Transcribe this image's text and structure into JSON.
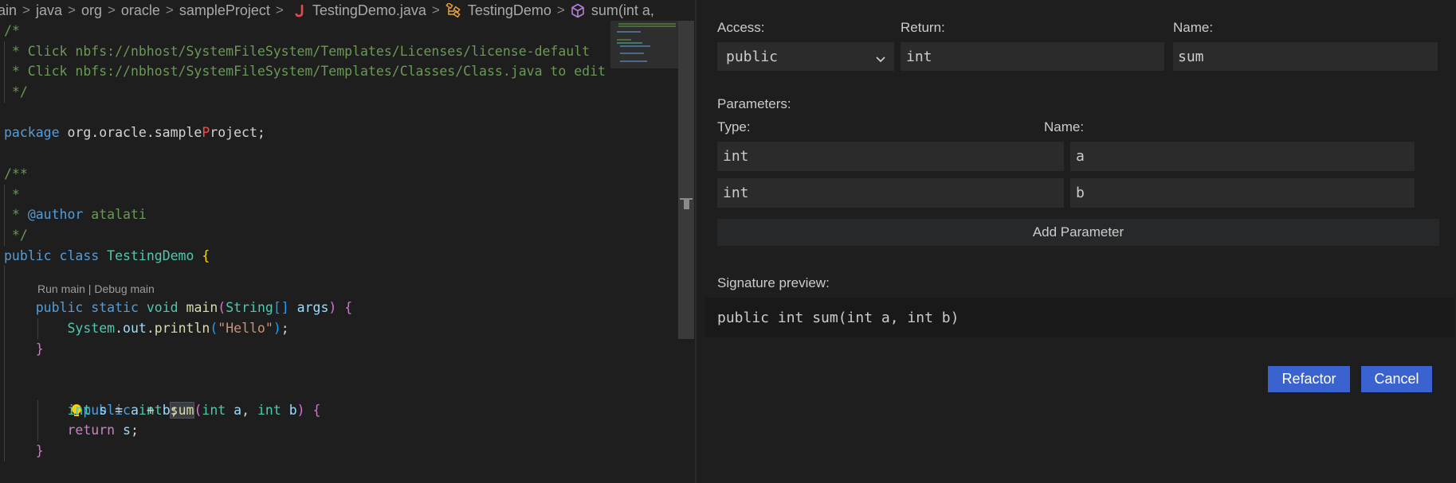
{
  "breadcrumb": {
    "items": [
      "ain",
      "java",
      "org",
      "oracle",
      "sampleProject",
      "TestingDemo.java",
      "TestingDemo",
      "sum(int a,"
    ],
    "icons": [
      "java-file-icon",
      "class-icon",
      "method-icon"
    ]
  },
  "editor": {
    "code": {
      "l1": "/*",
      "l2": " * Click nbfs://nbhost/SystemFileSystem/Templates/Licenses/license-default",
      "l3": " * Click nbfs://nbhost/SystemFileSystem/Templates/Classes/Class.java to edit",
      "l4": " */",
      "pkg_kw": "package",
      "pkg_a": " org.oracle.sample",
      "pkg_err": "P",
      "pkg_b": "roject;",
      "doc_open": "/**",
      "doc_star": " *",
      "doc_author_star": " * ",
      "doc_author_tag": "@author",
      "doc_author_name": " atalati",
      "doc_close": " */",
      "cls_public": "public",
      "cls_class": "class",
      "cls_name": "TestingDemo",
      "cls_brace": "{",
      "codelens_run": "Run main",
      "codelens_sep": " | ",
      "codelens_debug": "Debug main",
      "main_public": "public",
      "main_static": "static",
      "main_void": "void",
      "main_name": "main",
      "main_type": "String",
      "main_arr": "[]",
      "main_arg": "args",
      "println_sys": "System",
      "println_out": "out",
      "println_fn": "println",
      "println_str": "\"Hello\"",
      "sum_public": "public",
      "sum_int": "int",
      "sum_name": "sum",
      "sum_p1t": "int",
      "sum_p1": "a",
      "sum_p2t": "int",
      "sum_p2": "b",
      "body_int": "int",
      "body_s": "s",
      "body_a": "a",
      "body_b": "b",
      "ret_kw": "return",
      "ret_s": "s"
    }
  },
  "refactor": {
    "access_label": "Access:",
    "access_value": "public",
    "return_label": "Return:",
    "return_value": "int",
    "name_label": "Name:",
    "name_value": "sum",
    "parameters_label": "Parameters:",
    "param_type_label": "Type:",
    "param_name_label": "Name:",
    "parameters": [
      {
        "type": "int",
        "name": "a"
      },
      {
        "type": "int",
        "name": "b"
      }
    ],
    "add_parameter_label": "Add Parameter",
    "signature_label": "Signature preview:",
    "signature_value": "public int sum(int a, int b)",
    "refactor_button": "Refactor",
    "cancel_button": "Cancel"
  },
  "colors": {
    "accent_button": "#3a63cf",
    "background": "#1e1e1e",
    "input_background": "#2b2b2b"
  }
}
